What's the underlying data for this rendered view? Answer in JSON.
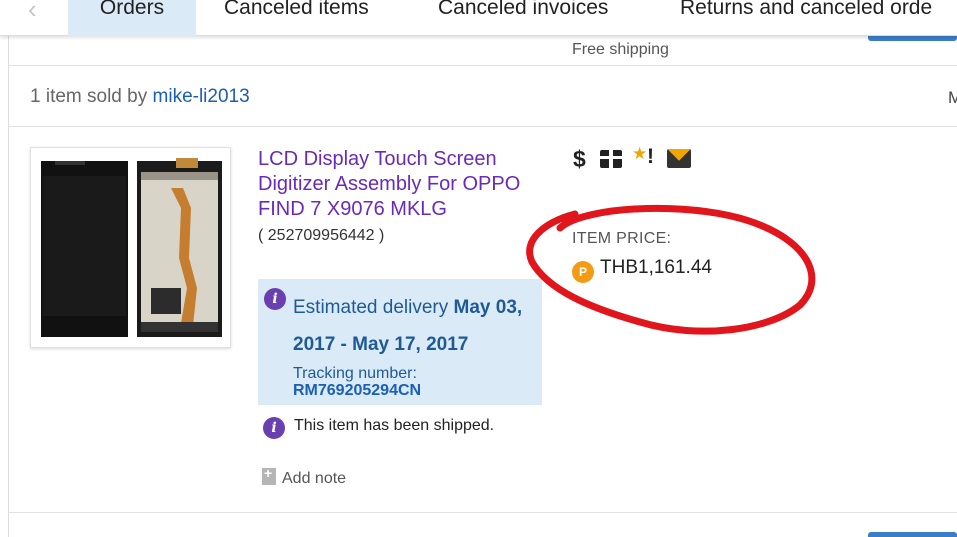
{
  "tabs": {
    "prev_icon": "chevron-left-icon",
    "items": [
      {
        "label": "Orders",
        "active": true
      },
      {
        "label": "Canceled items",
        "active": false
      },
      {
        "label": "Canceled invoices",
        "active": false
      },
      {
        "label": "Returns and canceled orde",
        "active": false
      }
    ]
  },
  "shipping_note": "Free shipping",
  "seller": {
    "prefix": "1 item sold by",
    "name": "mike-li2013",
    "right_truncated": "M"
  },
  "item": {
    "title": "LCD Display Touch Screen Digitizer Assembly For OPPO FIND 7 X9076 MKLG",
    "number": "( 252709956442 )",
    "image_alt": "LCD display front and back"
  },
  "delivery": {
    "prefix": "Estimated delivery",
    "dates": "May 03, 2017 - May 17, 2017",
    "tracking_label": "Tracking number:",
    "tracking_number": "RM769205294CN"
  },
  "status": "This item has been shipped.",
  "add_note": "Add note",
  "icons": [
    "dollar-icon",
    "package-icon",
    "star-alert-icon",
    "mail-icon"
  ],
  "price": {
    "label": "ITEM PRICE:",
    "value": "THB1,161.44",
    "coin_letter": "P"
  },
  "colors": {
    "link_purple": "#6a2ab7",
    "link_blue": "#1a5fb4",
    "info_bg": "#dbeaf7",
    "annotation_red": "#e0161c",
    "coin_orange": "#f29b13"
  }
}
